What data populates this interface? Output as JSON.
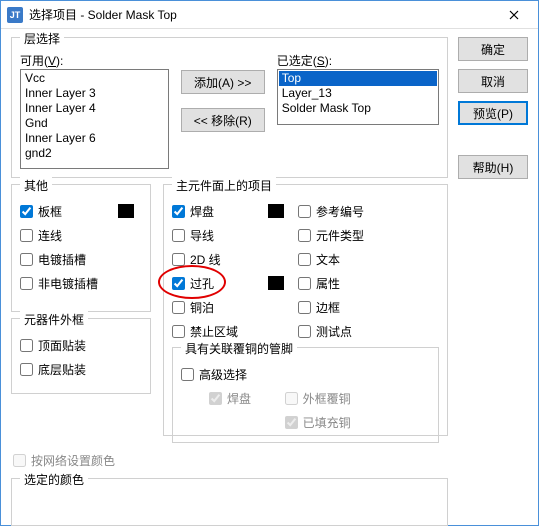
{
  "window": {
    "logo": "JT",
    "title": "选择项目 - Solder Mask Top"
  },
  "buttons": {
    "ok": "确定",
    "cancel": "取消",
    "preview": "预览(P)",
    "help": "帮助(H)",
    "add": "添加(A) >>",
    "remove": "<< 移除(R)"
  },
  "layer_group": {
    "title": "层选择",
    "available_label_pre": "可用(",
    "available_label_u": "V",
    "available_label_post": "):",
    "selected_label_pre": "已选定(",
    "selected_label_u": "S",
    "selected_label_post": "):",
    "available": [
      "Vcc",
      "Inner Layer 3",
      "Inner Layer 4",
      "Gnd",
      "Inner Layer 6",
      "gnd2"
    ],
    "selected": [
      "Top",
      "Layer_13",
      "Solder Mask Top"
    ]
  },
  "other": {
    "title": "其他",
    "board_outline": "板框",
    "connections": "连线",
    "plated_slots": "电镀插槽",
    "nonplated_slots": "非电镀插槽"
  },
  "component_outlines": {
    "title": "元器件外框",
    "top_mount": "顶面贴装",
    "bottom_mount": "底层贴装"
  },
  "top_items": {
    "title": "主元件面上的项目",
    "pads": "焊盘",
    "refdes": "参考编号",
    "traces": "导线",
    "part_type": "元件类型",
    "lines2d": "2D 线",
    "text": "文本",
    "vias": "过孔",
    "attributes": "属性",
    "copper": "铜泊",
    "outline": "边框",
    "keepouts": "禁止区域",
    "test_points": "测试点"
  },
  "assoc_copper": {
    "title": "具有关联覆铜的管脚",
    "advanced": "高级选择",
    "pads": "焊盘",
    "outline_copper": "外框覆铜",
    "filled": "已填充铜"
  },
  "by_net": "按网络设置颜色",
  "selected_color": "选定的颜色"
}
